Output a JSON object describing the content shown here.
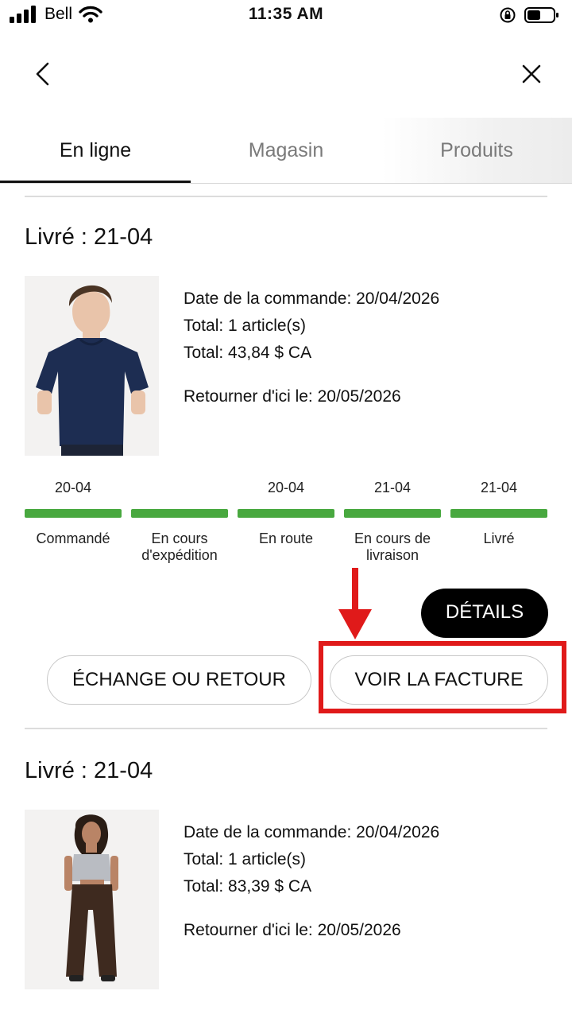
{
  "status_bar": {
    "carrier": "Bell",
    "time": "11:35 AM"
  },
  "nav": {
    "back_icon": "chevron-left-icon",
    "close_icon": "close-icon"
  },
  "tabs": [
    {
      "label": "En ligne",
      "active": true
    },
    {
      "label": "Magasin",
      "active": false
    },
    {
      "label": "Produits",
      "active": false
    }
  ],
  "orders": [
    {
      "title": "Livré : 21-04",
      "order_date": "Date de la commande: 20/04/2026",
      "items": "Total: 1 article(s)",
      "total": "Total: 43,84 $ CA",
      "return_by": "Retourner d'ici le: 20/05/2026",
      "tracker": [
        {
          "date": "20-04",
          "label": "Commandé",
          "progress": 1
        },
        {
          "date": "",
          "label": "En cours d'expédition",
          "progress": 1
        },
        {
          "date": "20-04",
          "label": "En route",
          "progress": 1
        },
        {
          "date": "21-04",
          "label": "En cours de livraison",
          "progress": 1
        },
        {
          "date": "21-04",
          "label": "Livré",
          "progress": 1
        }
      ],
      "details_button": "DÉTAILS",
      "exchange_button": "ÉCHANGE OU RETOUR",
      "invoice_button": "VOIR LA FACTURE"
    },
    {
      "title": "Livré : 21-04",
      "order_date": "Date de la commande: 20/04/2026",
      "items": "Total: 1 article(s)",
      "total": "Total: 83,39 $ CA",
      "return_by": "Retourner d'ici le: 20/05/2026"
    }
  ],
  "colors": {
    "progress": "#48a83f",
    "annotation": "#e01a1a",
    "details_bg": "#000000"
  }
}
